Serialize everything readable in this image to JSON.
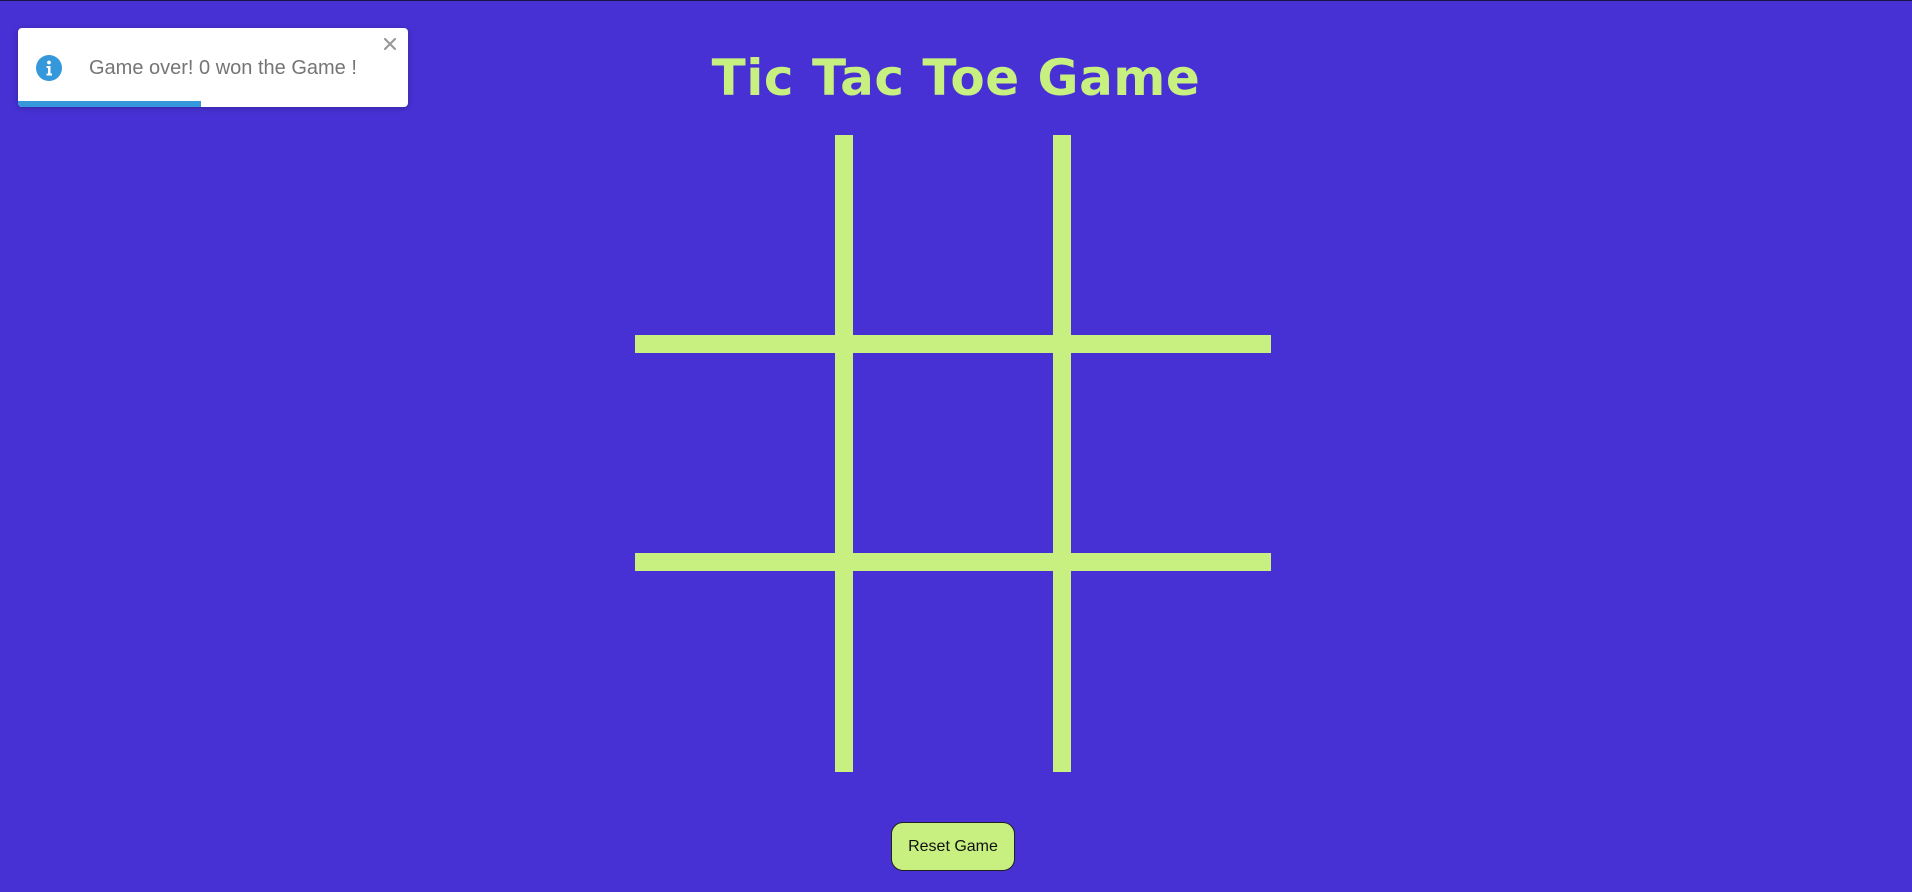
{
  "page": {
    "title": "Tic Tac Toe Game",
    "background_color": "#4731d4",
    "accent_color": "#c8f080"
  },
  "toast": {
    "icon": "info-icon",
    "message": "Game over! 0 won the Game !",
    "close_icon": "close-icon",
    "progress_fraction": 0.47,
    "progress_color": "#3498db"
  },
  "board": {
    "cells": [
      "",
      "",
      "",
      "",
      "",
      "",
      "",
      "",
      ""
    ]
  },
  "controls": {
    "reset_label": "Reset Game"
  }
}
